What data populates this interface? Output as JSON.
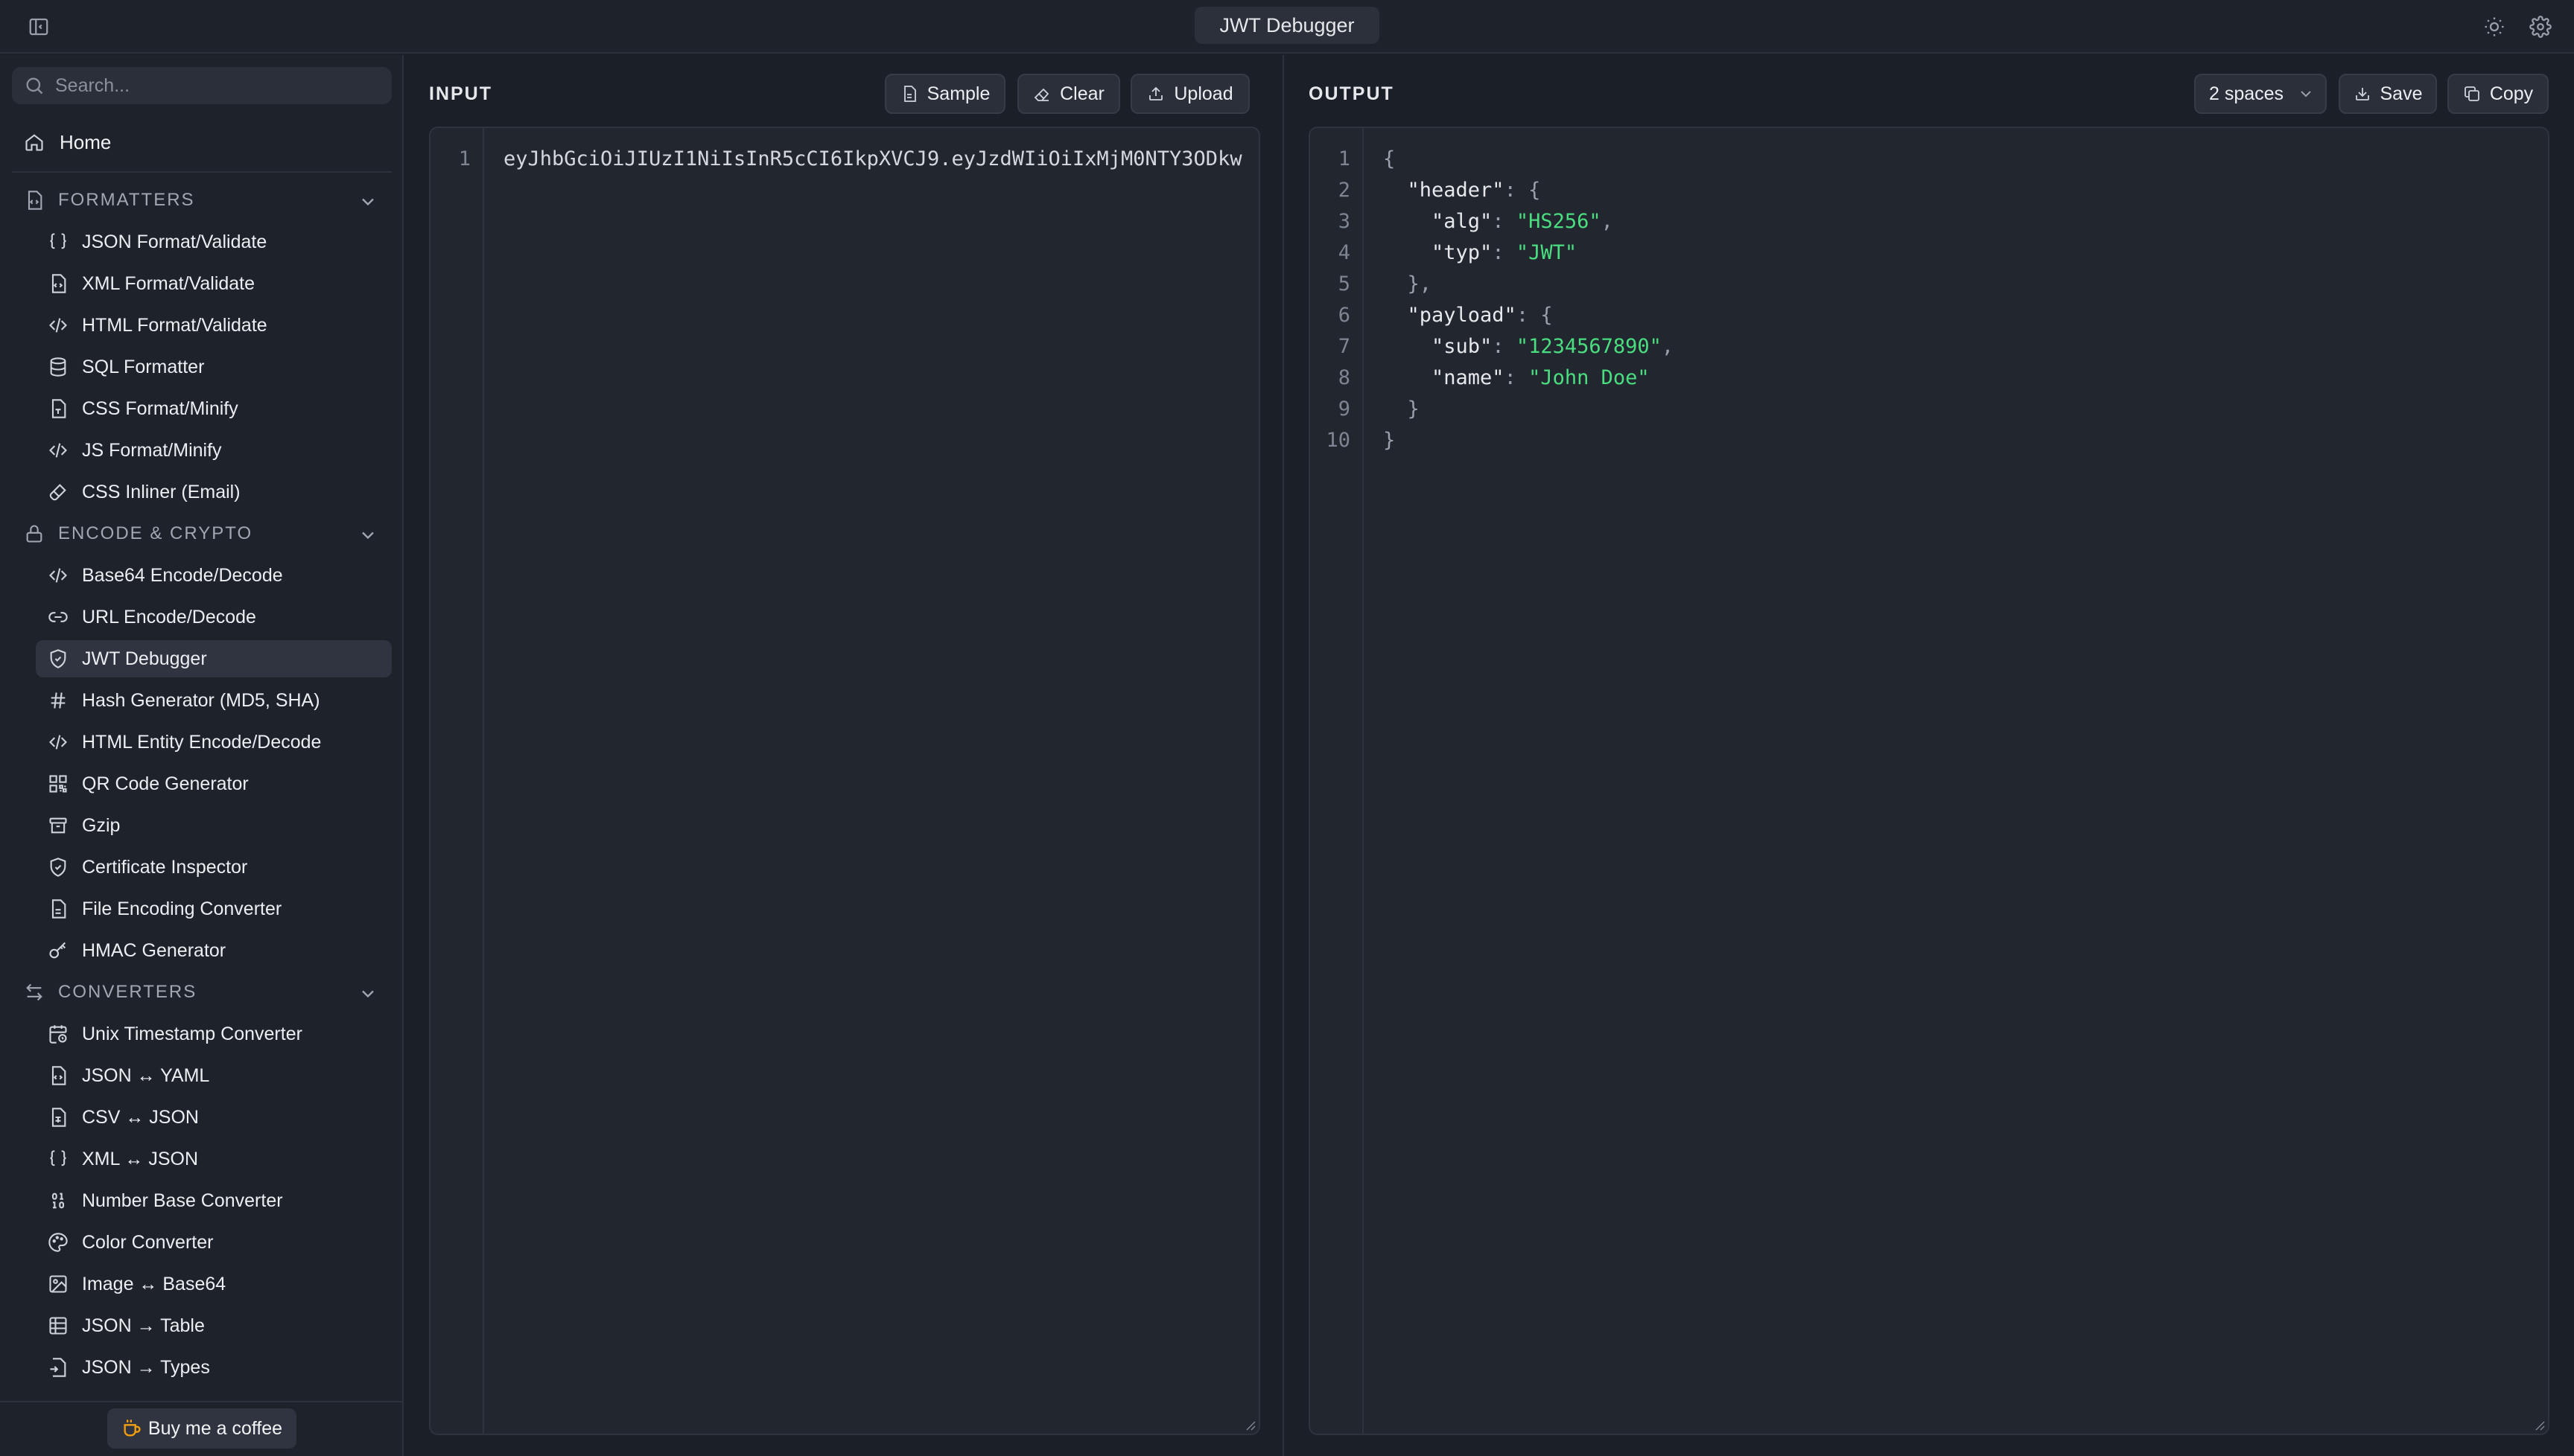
{
  "app": {
    "title": "JWT Debugger"
  },
  "sidebar": {
    "search_placeholder": "Search...",
    "home": "Home",
    "sections": [
      {
        "label": "FORMATTERS",
        "items": [
          "JSON Format/Validate",
          "XML Format/Validate",
          "HTML Format/Validate",
          "SQL Formatter",
          "CSS Format/Minify",
          "JS Format/Minify",
          "CSS Inliner (Email)"
        ]
      },
      {
        "label": "ENCODE & CRYPTO",
        "items": [
          "Base64 Encode/Decode",
          "URL Encode/Decode",
          "JWT Debugger",
          "Hash Generator (MD5, SHA)",
          "HTML Entity Encode/Decode",
          "QR Code Generator",
          "Gzip",
          "Certificate Inspector",
          "File Encoding Converter",
          "HMAC Generator"
        ]
      },
      {
        "label": "CONVERTERS",
        "items": [
          "Unix Timestamp Converter",
          "JSON ↔ YAML",
          "CSV ↔ JSON",
          "XML ↔ JSON",
          "Number Base Converter",
          "Color Converter",
          "Image ↔ Base64",
          "JSON → Table",
          "JSON → Types"
        ]
      }
    ],
    "active_item": "JWT Debugger",
    "coffee": "Buy me a coffee"
  },
  "input": {
    "title": "INPUT",
    "buttons": {
      "sample": "Sample",
      "clear": "Clear",
      "upload": "Upload"
    },
    "line_numbers": [
      "1"
    ],
    "value": "eyJhbGciOiJIUzI1NiIsInR5cCI6IkpXVCJ9.eyJzdWIiOiIxMjM0NTY3ODkw"
  },
  "output": {
    "title": "OUTPUT",
    "indent": "2 spaces",
    "buttons": {
      "save": "Save",
      "copy": "Copy"
    },
    "line_numbers": [
      "1",
      "2",
      "3",
      "4",
      "5",
      "6",
      "7",
      "8",
      "9",
      "10"
    ],
    "tokens": {
      "header_key": "\"header\"",
      "alg_key": "\"alg\"",
      "alg_val": "\"HS256\"",
      "typ_key": "\"typ\"",
      "typ_val": "\"JWT\"",
      "payload_key": "\"payload\"",
      "sub_key": "\"sub\"",
      "sub_val": "\"1234567890\"",
      "name_key": "\"name\"",
      "name_val": "\"John Doe\""
    }
  },
  "colors": {
    "string": "#4ade80",
    "background": "#1b1f27",
    "panel": "#22262f",
    "active_nav": "#2f3440"
  }
}
